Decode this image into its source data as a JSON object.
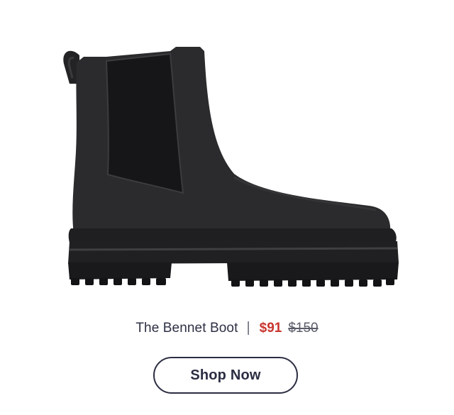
{
  "product": {
    "image_icon": "chelsea-boot-icon",
    "name": "The Bennet Boot",
    "divider": "|",
    "sale_price": "$91",
    "original_price": "$150"
  },
  "cta": {
    "label": "Shop Now"
  },
  "colors": {
    "text": "#2b2d42",
    "sale": "#c8352e",
    "boot": "#2a2a2c",
    "sole": "#1c1c1e"
  }
}
